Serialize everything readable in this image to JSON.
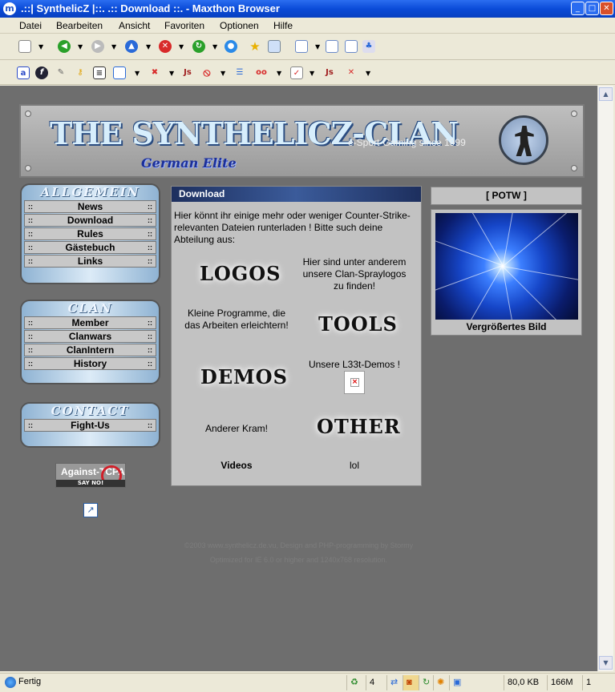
{
  "window": {
    "title": ".::| SynthelicZ |::. .:: Download ::. - Maxthon Browser"
  },
  "menu": [
    "Datei",
    "Bearbeiten",
    "Ansicht",
    "Favoriten",
    "Optionen",
    "Hilfe"
  ],
  "banner": {
    "logo": "THE SYNTHELICZ-CLAN",
    "sub": "German Elite",
    "slogan": "e-Sport-Gaming since 1999"
  },
  "nav": {
    "allgemein": {
      "title": "ALLGEMEIN",
      "items": [
        "News",
        "Download",
        "Rules",
        "Gästebuch",
        "Links"
      ]
    },
    "clan": {
      "title": "CLAN",
      "items": [
        "Member",
        "Clanwars",
        "ClanIntern",
        "History"
      ]
    },
    "contact": {
      "title": "CONTACT",
      "items": [
        "Fight-Us"
      ]
    }
  },
  "tcpa": {
    "text": "Against-TCPA",
    "sub": "SAY NO!"
  },
  "main": {
    "title": "Download",
    "intro": "Hier könnt ihr einige mehr oder weniger Counter-Strike-relevanten Dateien runterladen ! Bitte such deine Abteilung aus:",
    "logos": "LOGOS",
    "logos_desc": "Hier sind unter anderem unsere Clan-Spraylogos zu finden!",
    "tools_desc": "Kleine Programme, die das Arbeiten erleichtern!",
    "tools": "TOOLS",
    "demos": "DEMOS",
    "demos_desc": "Unsere L33t-Demos !",
    "other_desc": "Anderer Kram!",
    "other": "OTHER",
    "videos": "Videos",
    "lol": "lol"
  },
  "potw": {
    "title": "[ POTW ]",
    "caption": "Vergrößertes Bild"
  },
  "footer": {
    "line1": "©2003 www.synthelicz.de.vu, Design and PHP-programming by Stormy",
    "line2": "Optimized for IE 6.0 or higher and 1240x768 resolution."
  },
  "status": {
    "text": "Fertig",
    "count": "4",
    "size": "80,0 KB",
    "mem": "166M",
    "page": "1"
  }
}
